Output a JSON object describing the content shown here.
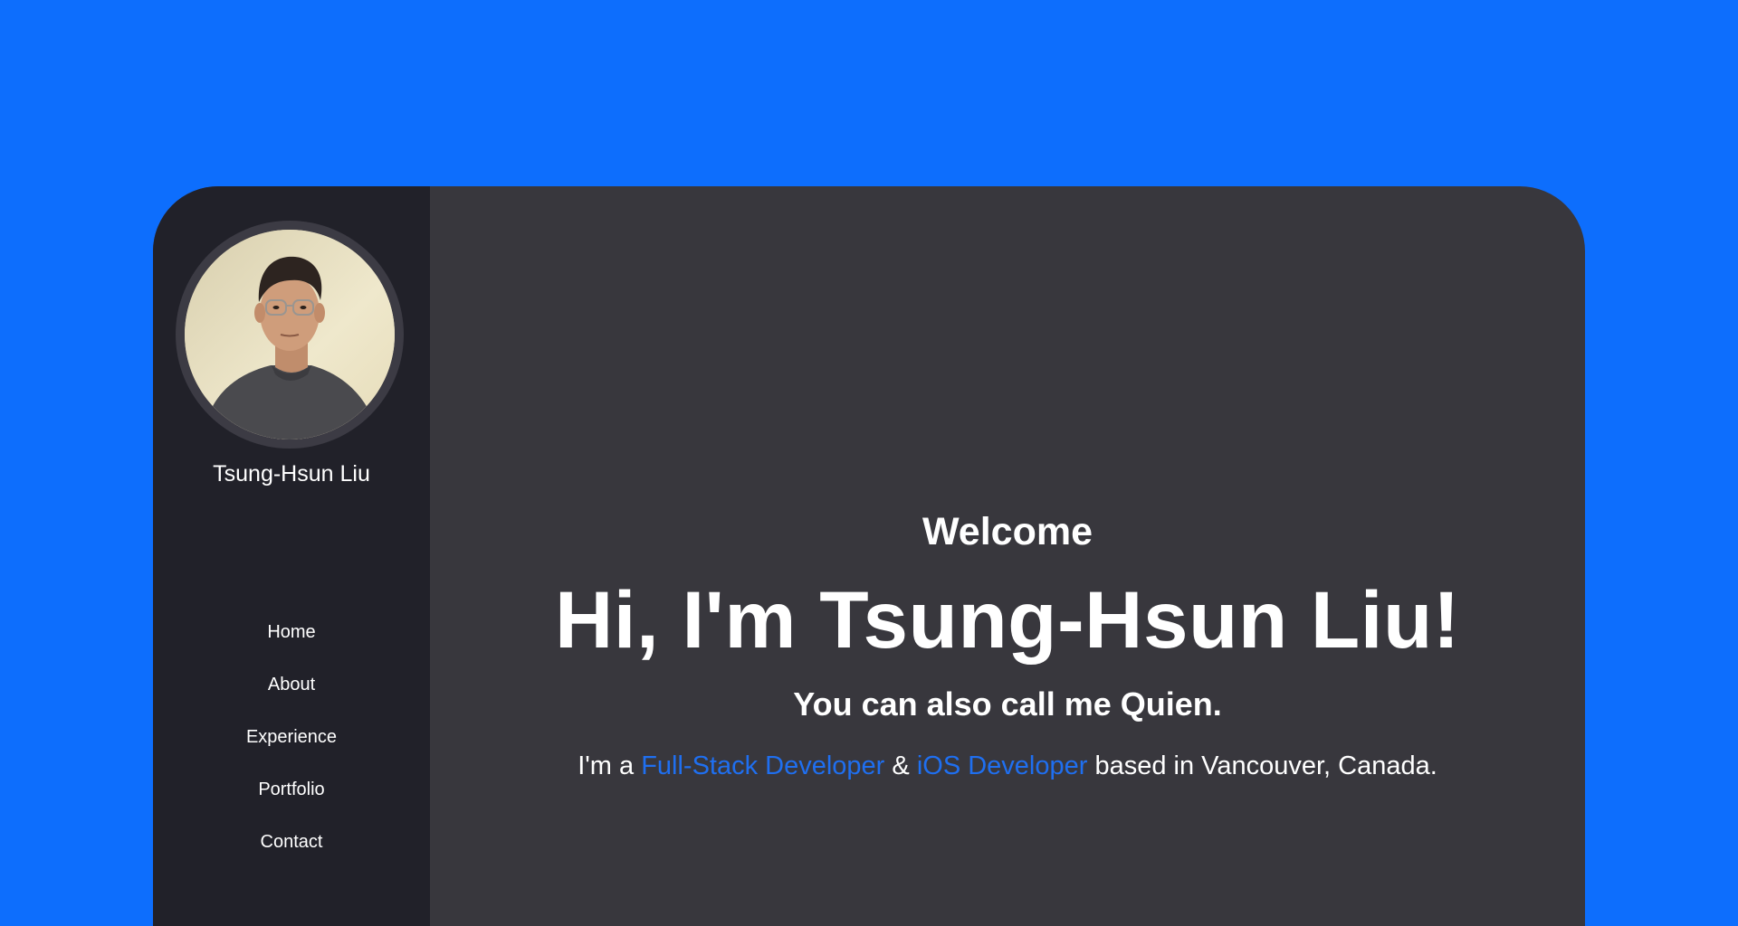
{
  "colors": {
    "background": "#0d6efd",
    "sidebar": "#212129",
    "main_panel": "#38373d",
    "accent": "#1f6ff0",
    "text": "#ffffff"
  },
  "sidebar": {
    "name": "Tsung-Hsun Liu",
    "avatar_icon": "profile-photo",
    "nav": [
      {
        "label": "Home"
      },
      {
        "label": "About"
      },
      {
        "label": "Experience"
      },
      {
        "label": "Portfolio"
      },
      {
        "label": "Contact"
      }
    ]
  },
  "hero": {
    "welcome": "Welcome",
    "headline": "Hi, I'm Tsung-Hsun Liu!",
    "subhead": "You can also call me Quien.",
    "tagline": {
      "prefix": "I'm a ",
      "role1": "Full-Stack Developer",
      "amp": " & ",
      "role2": "iOS Developer",
      "suffix": " based in Vancouver, Canada."
    }
  }
}
